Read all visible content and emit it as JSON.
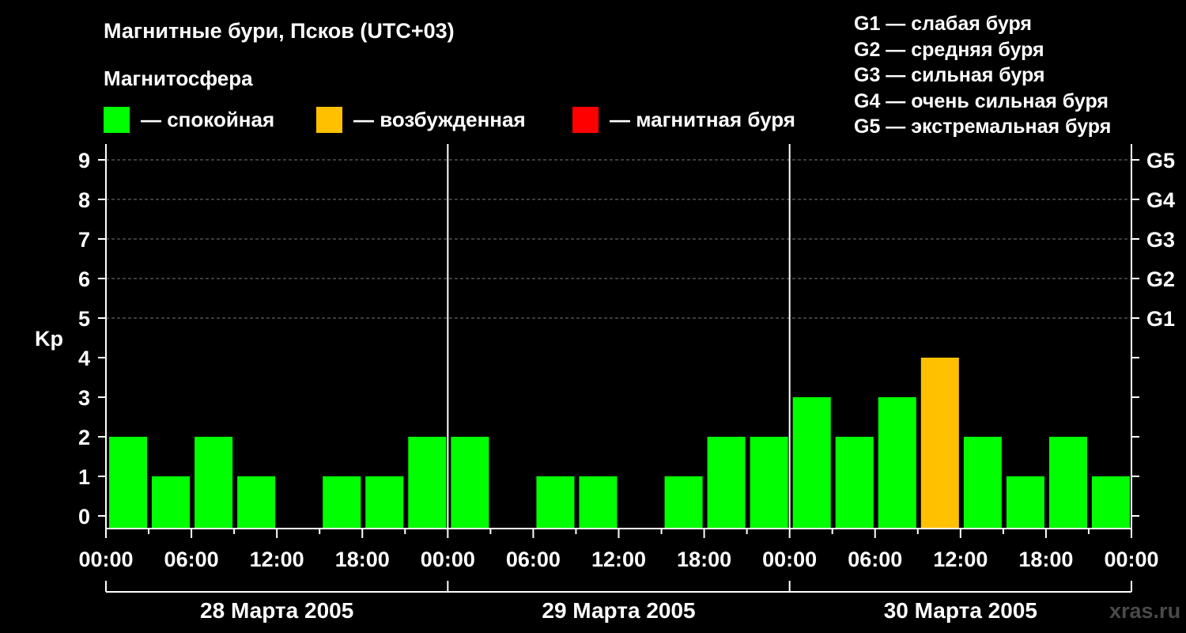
{
  "title": "Магнитные бури, Псков (UTC+03)",
  "magnetosphere": {
    "heading": "Магнитосфера",
    "items": [
      {
        "color": "#00ff00",
        "label": "— спокойная"
      },
      {
        "color": "#ffc000",
        "label": "— возбужденная"
      },
      {
        "color": "#ff0000",
        "label": "— магнитная буря"
      }
    ]
  },
  "storm_levels": [
    "G1 — слабая буря",
    "G2 — средняя буря",
    "G3 — сильная буря",
    "G4 — очень сильная буря",
    "G5 — экстремальная буря"
  ],
  "watermark": "xras.ru",
  "chart_data": {
    "type": "bar",
    "title": "Магнитные бури, Псков (UTC+03)",
    "ylabel": "Kp",
    "ylim": [
      0,
      9
    ],
    "y_ticks": [
      "0",
      "1",
      "2",
      "3",
      "4",
      "5",
      "6",
      "7",
      "8",
      "9"
    ],
    "right_ticks": [
      {
        "kp": 5,
        "label": "G1"
      },
      {
        "kp": 6,
        "label": "G2"
      },
      {
        "kp": 7,
        "label": "G3"
      },
      {
        "kp": 8,
        "label": "G4"
      },
      {
        "kp": 9,
        "label": "G5"
      }
    ],
    "gridlines": [
      5,
      6,
      7,
      8,
      9
    ],
    "x_tick_labels": [
      "00:00",
      "06:00",
      "12:00",
      "18:00",
      "00:00",
      "06:00",
      "12:00",
      "18:00",
      "00:00",
      "06:00",
      "12:00",
      "18:00",
      "00:00"
    ],
    "days": [
      "28 Марта 2005",
      "29 Марта 2005",
      "30 Марта 2005"
    ],
    "interval_hours": 3,
    "colors": {
      "quiet": "#00ff00",
      "active": "#ffc000",
      "storm": "#ff0000"
    },
    "series": [
      {
        "values": [
          2,
          1,
          2,
          1,
          0,
          1,
          1,
          2,
          2,
          0,
          1,
          1,
          0,
          1,
          2,
          2,
          3,
          2,
          3,
          4,
          2,
          1,
          2,
          1
        ]
      }
    ]
  }
}
